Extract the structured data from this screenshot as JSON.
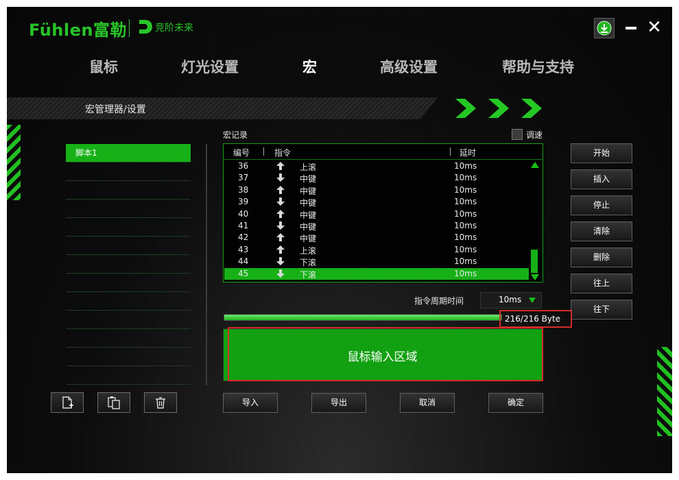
{
  "header": {
    "brand": "Fühlen富勒",
    "slogan": "竞阶未来"
  },
  "nav": {
    "tabs": [
      {
        "label": "鼠标"
      },
      {
        "label": "灯光设置"
      },
      {
        "label": "宏"
      },
      {
        "label": "高级设置"
      },
      {
        "label": "帮助与支持"
      }
    ],
    "active": "宏"
  },
  "banner": {
    "title": "宏管理器/设置"
  },
  "scripts": {
    "items": [
      {
        "label": "脚本1"
      }
    ]
  },
  "macro": {
    "record_label": "宏记录",
    "speed_label": "调速",
    "columns": {
      "index": "编号",
      "command": "指令",
      "delay": "延时"
    },
    "rows": [
      {
        "index": "36",
        "direction": "up",
        "command": "上滚",
        "delay": "10ms"
      },
      {
        "index": "37",
        "direction": "down",
        "command": "中键",
        "delay": "10ms"
      },
      {
        "index": "38",
        "direction": "up",
        "command": "中键",
        "delay": "10ms"
      },
      {
        "index": "39",
        "direction": "down",
        "command": "中键",
        "delay": "10ms"
      },
      {
        "index": "40",
        "direction": "up",
        "command": "中键",
        "delay": "10ms"
      },
      {
        "index": "41",
        "direction": "down",
        "command": "中键",
        "delay": "10ms"
      },
      {
        "index": "42",
        "direction": "up",
        "command": "中键",
        "delay": "10ms"
      },
      {
        "index": "43",
        "direction": "up",
        "command": "上滚",
        "delay": "10ms"
      },
      {
        "index": "44",
        "direction": "down",
        "command": "下滚",
        "delay": "10ms"
      },
      {
        "index": "45",
        "direction": "down",
        "command": "下滚",
        "delay": "10ms",
        "selected": true
      }
    ],
    "cycle_label": "指令周期时间",
    "cycle_value": "10ms",
    "bytes_text": "216/216 Byte",
    "usage_fraction": 1.0,
    "input_area_label": "鼠标输入区域"
  },
  "side_buttons": {
    "start": "开始",
    "insert": "插入",
    "stop": "停止",
    "clear": "清除",
    "delete": "删除",
    "up": "往上",
    "down": "往下"
  },
  "bottom_buttons": {
    "import": "导入",
    "export": "导出",
    "cancel": "取消",
    "confirm": "确定"
  },
  "colors": {
    "accent": "#15b015",
    "highlight_border": "#d32a2a"
  },
  "icons": {
    "new_script": "new-file-icon",
    "copy_script": "copy-paste-icon",
    "delete_script": "trash-icon",
    "download": "download-icon"
  }
}
